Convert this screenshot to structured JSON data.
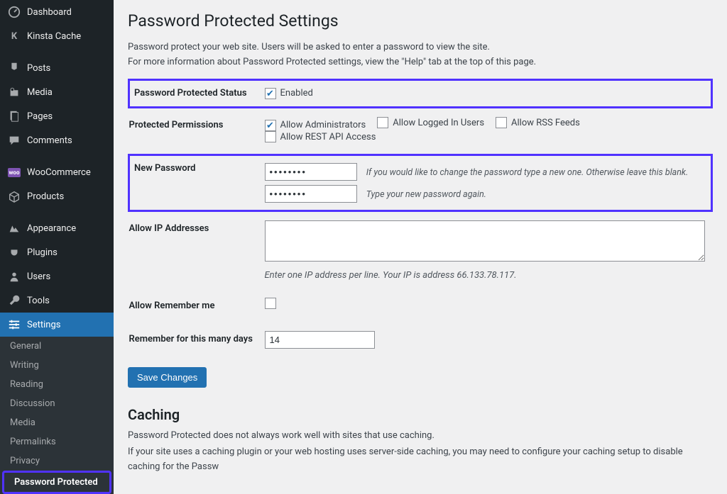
{
  "sidebar": {
    "main": [
      {
        "icon": "dash",
        "label": "Dashboard"
      },
      {
        "icon": "k",
        "label": "Kinsta Cache"
      },
      {
        "icon": "pin",
        "label": "Posts",
        "sep_before": true
      },
      {
        "icon": "media",
        "label": "Media"
      },
      {
        "icon": "page",
        "label": "Pages"
      },
      {
        "icon": "comm",
        "label": "Comments"
      },
      {
        "icon": "woo",
        "label": "WooCommerce",
        "sep_before": true
      },
      {
        "icon": "prod",
        "label": "Products"
      },
      {
        "icon": "app",
        "label": "Appearance",
        "sep_before": true
      },
      {
        "icon": "plug",
        "label": "Plugins"
      },
      {
        "icon": "user",
        "label": "Users"
      },
      {
        "icon": "tool",
        "label": "Tools"
      },
      {
        "icon": "set",
        "label": "Settings",
        "active": true
      }
    ],
    "settings_sub": [
      {
        "label": "General"
      },
      {
        "label": "Writing"
      },
      {
        "label": "Reading"
      },
      {
        "label": "Discussion"
      },
      {
        "label": "Media"
      },
      {
        "label": "Permalinks"
      },
      {
        "label": "Privacy"
      },
      {
        "label": "Password Protected",
        "current": true,
        "hl": true
      }
    ]
  },
  "page": {
    "title": "Password Protected Settings",
    "desc1": "Password protect your web site. Users will be asked to enter a password to view the site.",
    "desc2": "For more information about Password Protected settings, view the \"Help\" tab at the top of this page.",
    "status_label": "Password Protected Status",
    "status_enabled": "Enabled",
    "perm_label": "Protected Permissions",
    "perm_options": [
      {
        "label": "Allow Administrators",
        "checked": true
      },
      {
        "label": "Allow Logged In Users",
        "checked": false
      },
      {
        "label": "Allow RSS Feeds",
        "checked": false
      },
      {
        "label": "Allow REST API Access",
        "checked": false
      }
    ],
    "newpw_label": "New Password",
    "newpw_hint1": "If you would like to change the password type a new one. Otherwise leave this blank.",
    "newpw_hint2": "Type your new password again.",
    "pw_value": "••••••••",
    "ip_label": "Allow IP Addresses",
    "ip_note": "Enter one IP address per line. Your IP is address 66.133.78.117.",
    "remember_label": "Allow Remember me",
    "days_label": "Remember for this many days",
    "days_value": "14",
    "save": "Save Changes",
    "caching_h": "Caching",
    "caching_p1": "Password Protected does not always work well with sites that use caching.",
    "caching_p2": "If your site uses a caching plugin or your web hosting uses server-side caching, you may need to configure your caching setup to disable caching for the Passw"
  }
}
